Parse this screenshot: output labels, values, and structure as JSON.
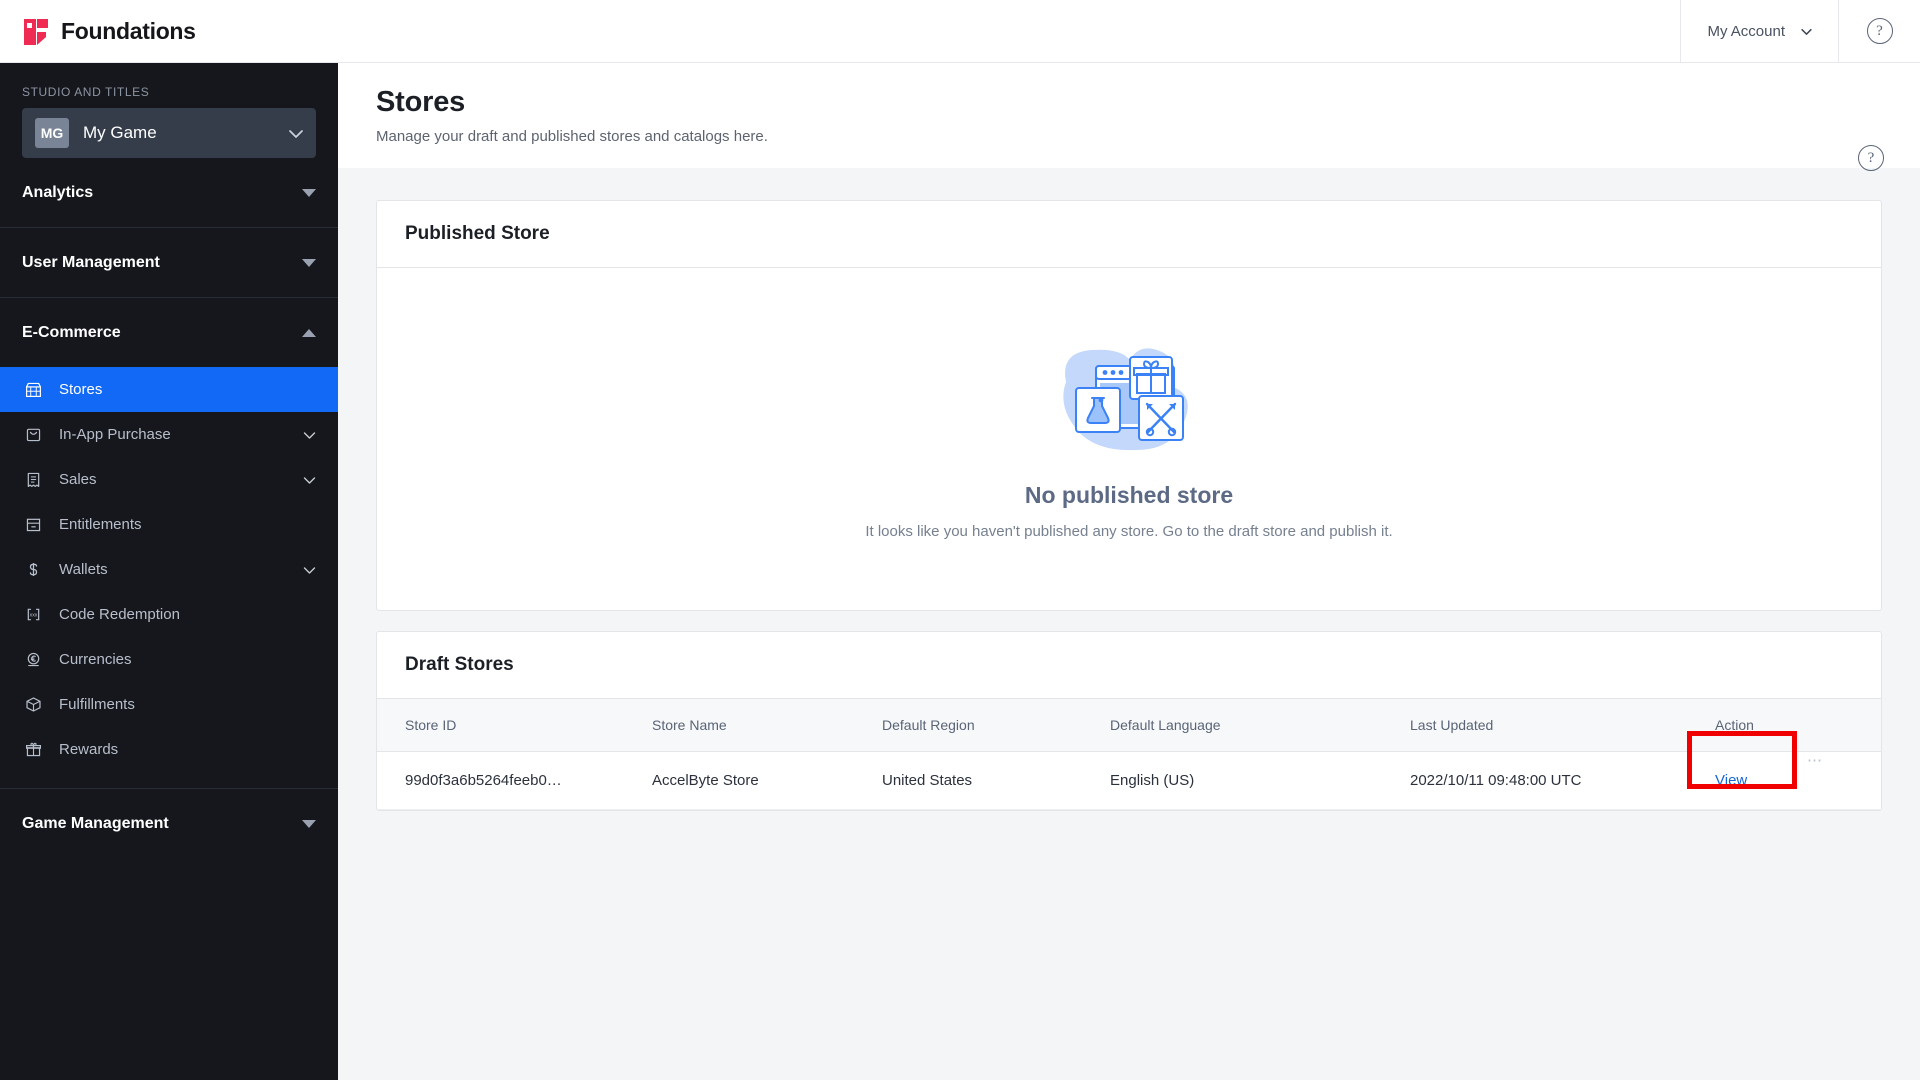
{
  "brand": {
    "name": "Foundations",
    "logo_colors": {
      "primary": "#ef2a53",
      "dark": "#15161a"
    }
  },
  "topbar": {
    "account_label": "My Account",
    "account_chevron_icon": "chevron-down-icon",
    "help_icon": "question-circle-icon"
  },
  "sidebar": {
    "studio_label": "STUDIO AND TITLES",
    "game": {
      "initials": "MG",
      "name": "My Game",
      "chevron_icon": "chevron-down-icon"
    },
    "sections": [
      {
        "title": "Analytics",
        "state": "collapsed",
        "toggle_icon": "triangle-down-icon",
        "items": []
      },
      {
        "title": "User Management",
        "state": "collapsed",
        "toggle_icon": "triangle-down-icon",
        "items": []
      },
      {
        "title": "E-Commerce",
        "state": "expanded",
        "toggle_icon": "triangle-up-icon",
        "items": [
          {
            "label": "Stores",
            "icon": "storefront-icon",
            "active": true,
            "expandable": false
          },
          {
            "label": "In-App Purchase",
            "icon": "shopping-bag-icon",
            "active": false,
            "expandable": true
          },
          {
            "label": "Sales",
            "icon": "receipt-icon",
            "active": false,
            "expandable": true
          },
          {
            "label": "Entitlements",
            "icon": "entitlement-box-icon",
            "active": false,
            "expandable": false
          },
          {
            "label": "Wallets",
            "icon": "dollar-sign-icon",
            "active": false,
            "expandable": true
          },
          {
            "label": "Code Redemption",
            "icon": "code-brackets-icon",
            "active": false,
            "expandable": false
          },
          {
            "label": "Currencies",
            "icon": "coin-euro-icon",
            "active": false,
            "expandable": false
          },
          {
            "label": "Fulfillments",
            "icon": "package-box-icon",
            "active": false,
            "expandable": false
          },
          {
            "label": "Rewards",
            "icon": "gift-icon",
            "active": false,
            "expandable": false
          }
        ]
      },
      {
        "title": "Game Management",
        "state": "collapsed",
        "toggle_icon": "triangle-down-icon",
        "items": []
      }
    ],
    "active_accent_color": "#1169f5",
    "background_color": "#15171c"
  },
  "page": {
    "title": "Stores",
    "subtitle": "Manage your draft and published stores and catalogs here.",
    "help_icon": "question-circle-icon"
  },
  "published_store_card": {
    "title": "Published Store",
    "empty_illustration_icon": "store-catalog-illustration",
    "empty_title": "No published store",
    "empty_desc": "It looks like you haven't published any store. Go to the draft store and publish it."
  },
  "draft_stores_card": {
    "title": "Draft Stores",
    "columns": [
      "Store ID",
      "Store Name",
      "Default Region",
      "Default Language",
      "Last Updated",
      "Action"
    ],
    "rows": [
      {
        "store_id": "99d0f3a6b5264feeb0…",
        "store_name": "AccelByte Store",
        "default_region": "United States",
        "default_language": "English (US)",
        "last_updated": "2022/10/11 09:48:00 UTC",
        "action_label": "View",
        "action_menu": "⋯"
      }
    ],
    "highlight": {
      "target": "View",
      "color": "#f00000"
    }
  }
}
